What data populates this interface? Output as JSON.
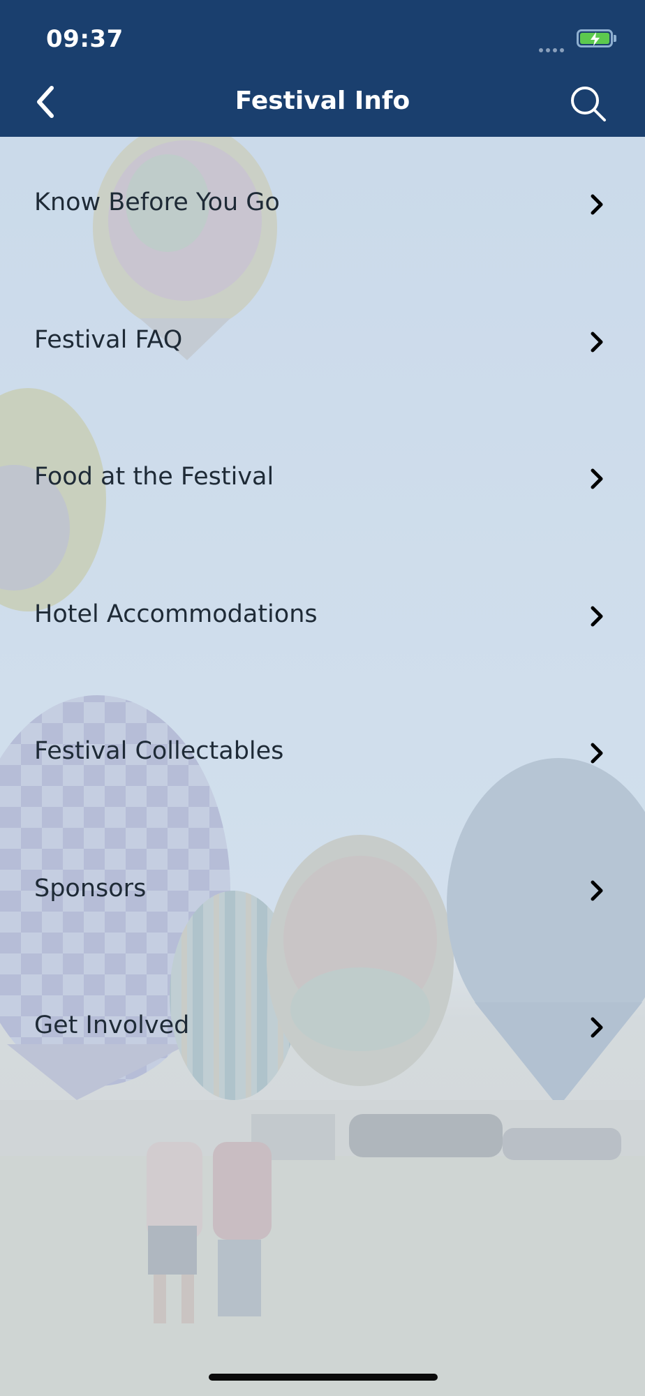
{
  "status_bar": {
    "time": "09:37"
  },
  "nav_bar": {
    "title": "Festival Info",
    "back_icon": "chevron-left-icon",
    "search_icon": "search-icon"
  },
  "menu": {
    "items": [
      {
        "label": "Know Before You Go"
      },
      {
        "label": "Festival FAQ"
      },
      {
        "label": "Food at the Festival"
      },
      {
        "label": "Hotel Accommodations"
      },
      {
        "label": "Festival Collectables"
      },
      {
        "label": "Sponsors"
      },
      {
        "label": "Get Involved"
      }
    ],
    "item_icon": "chevron-right-icon"
  },
  "colors": {
    "header": "#1a3f6e",
    "background": "#cddbe9",
    "text": "#1e2a36",
    "battery": "#5cc94e"
  }
}
